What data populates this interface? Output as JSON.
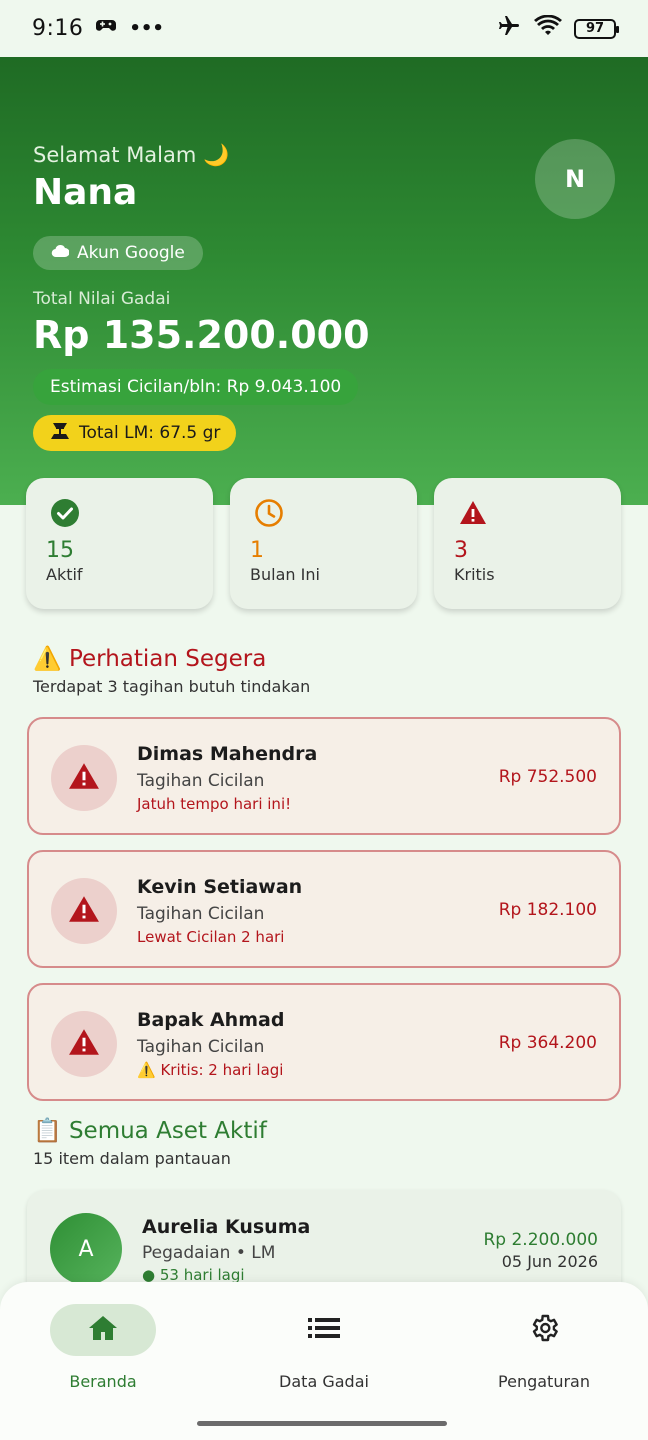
{
  "status_bar": {
    "time": "9:16",
    "battery": "97"
  },
  "header": {
    "greeting": "Selamat Malam 🌙",
    "user_name": "Nana",
    "avatar_initial": "N",
    "account_chip": "Akun Google",
    "total_label": "Total Nilai Gadai",
    "total_value": "Rp 135.200.000",
    "estimate_chip": "Estimasi Cicilan/bln: Rp 9.043.100",
    "gold_chip": "Total LM: 67.5 gr"
  },
  "stats": [
    {
      "value": "15",
      "label": "Aktif",
      "color": "#2e7d32",
      "icon": "check-circle-icon"
    },
    {
      "value": "1",
      "label": "Bulan Ini",
      "color": "#e67e00",
      "icon": "clock-icon"
    },
    {
      "value": "3",
      "label": "Kritis",
      "color": "#b3151c",
      "icon": "warning-icon"
    }
  ],
  "attention": {
    "title": "⚠️ Perhatian Segera",
    "subtitle": "Terdapat 3 tagihan butuh tindakan",
    "items": [
      {
        "name": "Dimas Mahendra",
        "type": "Tagihan Cicilan",
        "status": "Jatuh tempo hari ini!",
        "amount": "Rp 752.500"
      },
      {
        "name": "Kevin Setiawan",
        "type": "Tagihan Cicilan",
        "status": "Lewat Cicilan 2 hari",
        "amount": "Rp 182.100"
      },
      {
        "name": "Bapak Ahmad",
        "type": "Tagihan Cicilan",
        "status": "⚠️ Kritis: 2 hari lagi",
        "amount": "Rp 364.200"
      }
    ]
  },
  "assets": {
    "title": "📋 Semua Aset Aktif",
    "subtitle": "15 item dalam pantauan",
    "items": [
      {
        "initial": "A",
        "name": "Aurelia Kusuma",
        "type": "Pegadaian  •  LM",
        "days": "● 53 hari lagi",
        "amount": "Rp 2.200.000",
        "date": "05 Jun 2026"
      }
    ]
  },
  "bottom_nav": [
    {
      "label": "Beranda",
      "icon": "home-icon",
      "active": true
    },
    {
      "label": "Data Gadai",
      "icon": "list-icon",
      "active": false
    },
    {
      "label": "Pengaturan",
      "icon": "gear-icon",
      "active": false
    }
  ],
  "colors": {
    "primary": "#2e7d32",
    "danger": "#b3151c",
    "gold": "#f2d21b",
    "warning": "#e67e00"
  }
}
